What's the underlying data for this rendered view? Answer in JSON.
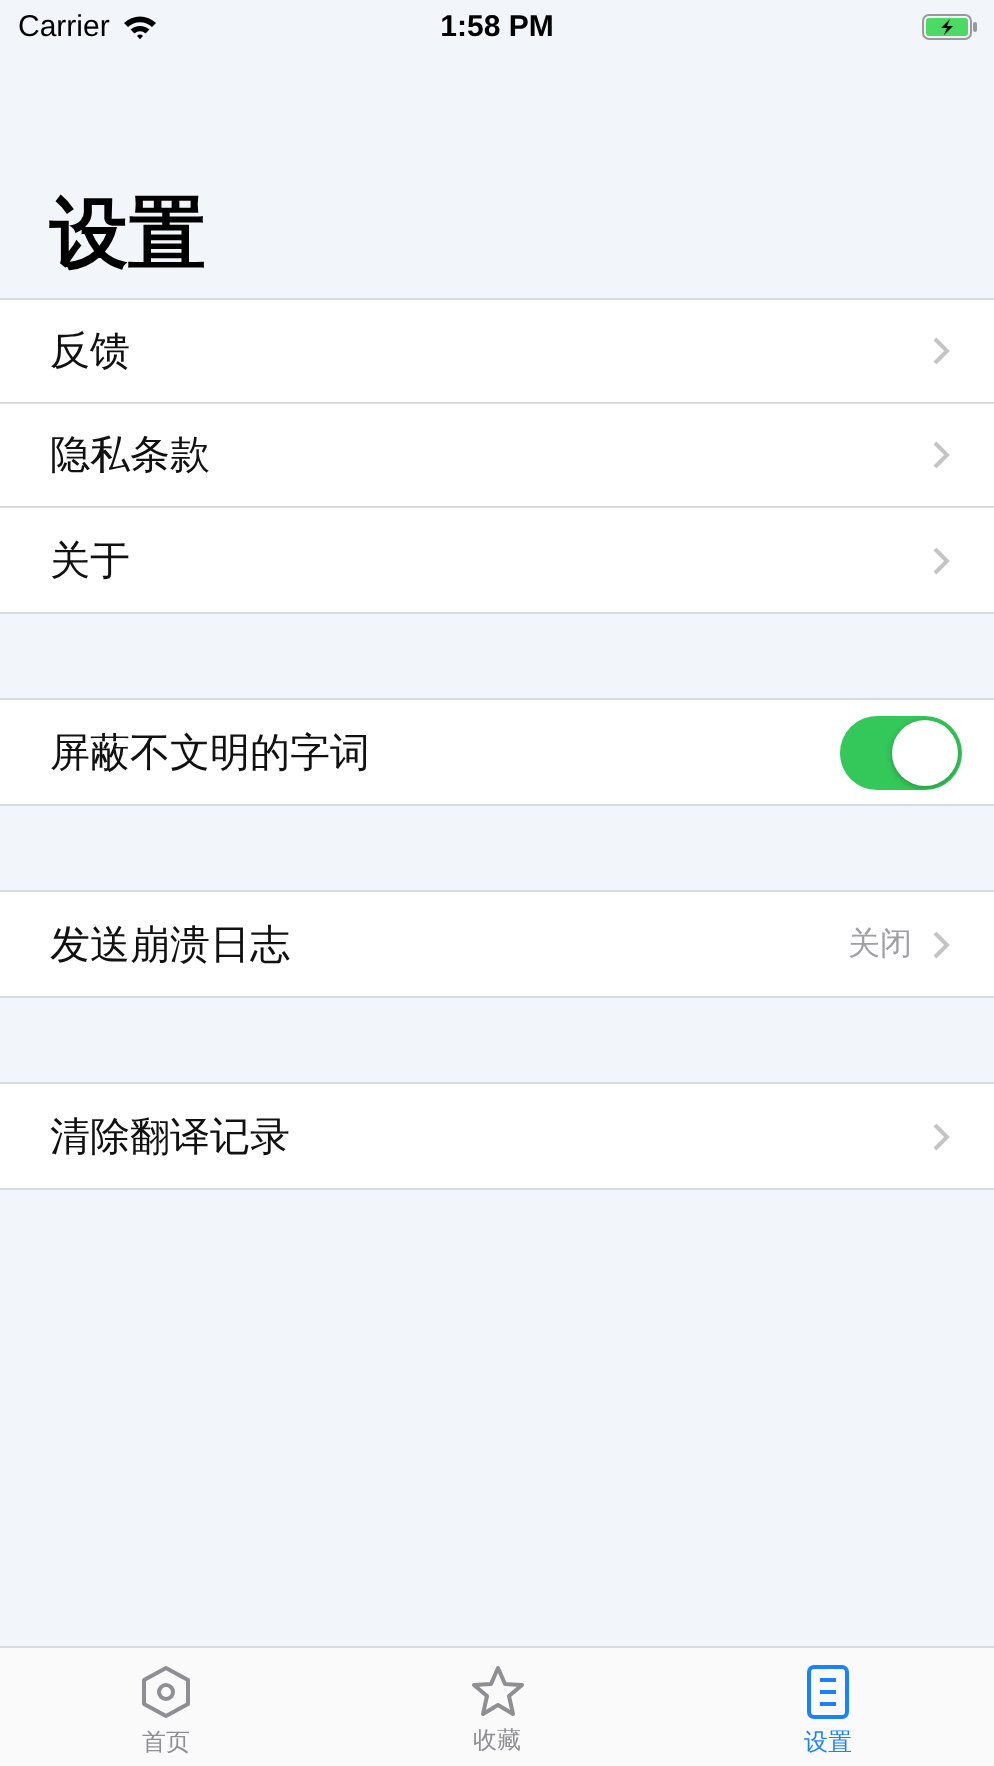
{
  "status_bar": {
    "carrier": "Carrier",
    "time": "1:58 PM"
  },
  "title": "设置",
  "groups": [
    {
      "rows": [
        {
          "kind": "link",
          "label": "反馈"
        },
        {
          "kind": "link",
          "label": "隐私条款"
        },
        {
          "kind": "link",
          "label": "关于"
        }
      ]
    },
    {
      "rows": [
        {
          "kind": "toggle",
          "label": "屏蔽不文明的字词",
          "on": true
        }
      ]
    },
    {
      "rows": [
        {
          "kind": "value",
          "label": "发送崩溃日志",
          "value": "关闭"
        }
      ]
    },
    {
      "rows": [
        {
          "kind": "link",
          "label": "清除翻译记录"
        }
      ]
    }
  ],
  "tab_bar": [
    {
      "label": "首页",
      "selected": false
    },
    {
      "label": "收藏",
      "selected": false
    },
    {
      "label": "设置",
      "selected": true
    }
  ]
}
